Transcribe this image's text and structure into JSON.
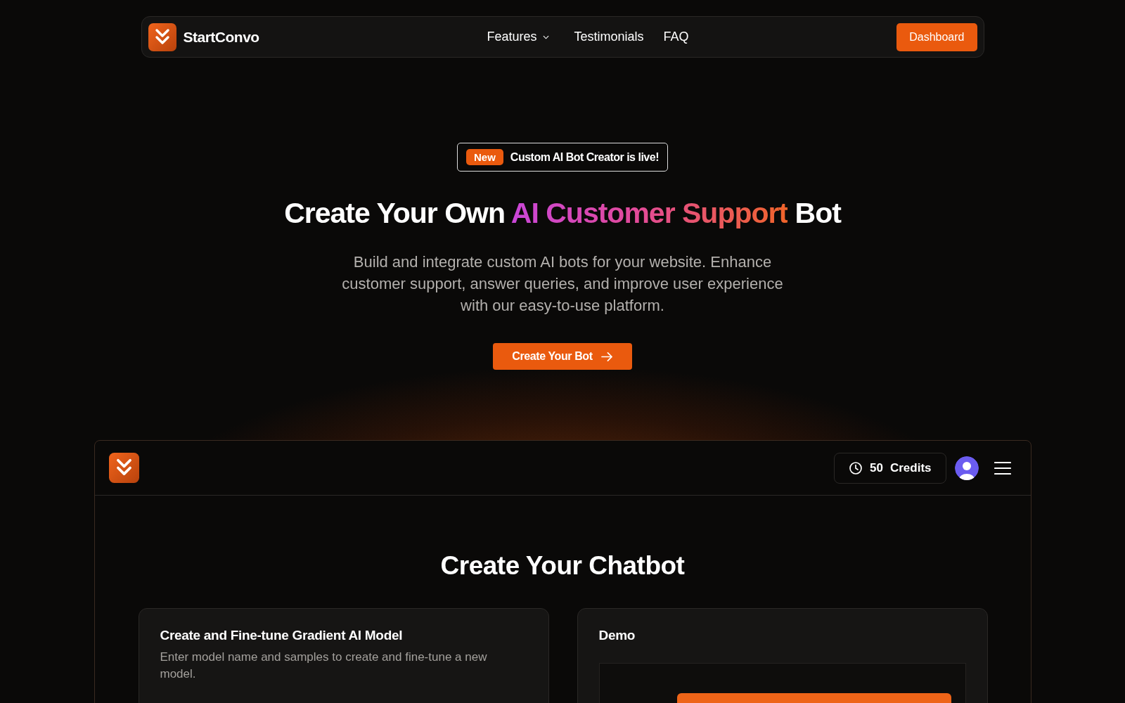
{
  "nav": {
    "brand": "StartConvo",
    "links": [
      {
        "label": "Features",
        "has_menu": true
      },
      {
        "label": "Testimonials",
        "has_menu": false
      },
      {
        "label": "FAQ",
        "has_menu": false
      }
    ],
    "cta": "Dashboard"
  },
  "hero": {
    "badge": {
      "tag": "New",
      "text": "Custom AI Bot Creator is live!"
    },
    "headline": [
      {
        "text": "Create Your Own ",
        "highlight": false
      },
      {
        "text": "AI Customer Support",
        "highlight": true
      },
      {
        "text": " Bot",
        "highlight": false
      }
    ],
    "description": "Build and integrate custom AI bots for your website. Enhance customer support, answer queries, and improve user experience with our easy-to-use platform.",
    "button": "Create Your Bot"
  },
  "app": {
    "credits": {
      "count": "50",
      "label": "Credits"
    },
    "title": "Create Your Chatbot",
    "cards": [
      {
        "kind": "form",
        "title": "Create and Fine-tune Gradient AI Model",
        "description": "Enter model name and samples to create and fine-tune a new model."
      },
      {
        "kind": "demo",
        "title": "Demo"
      }
    ]
  }
}
